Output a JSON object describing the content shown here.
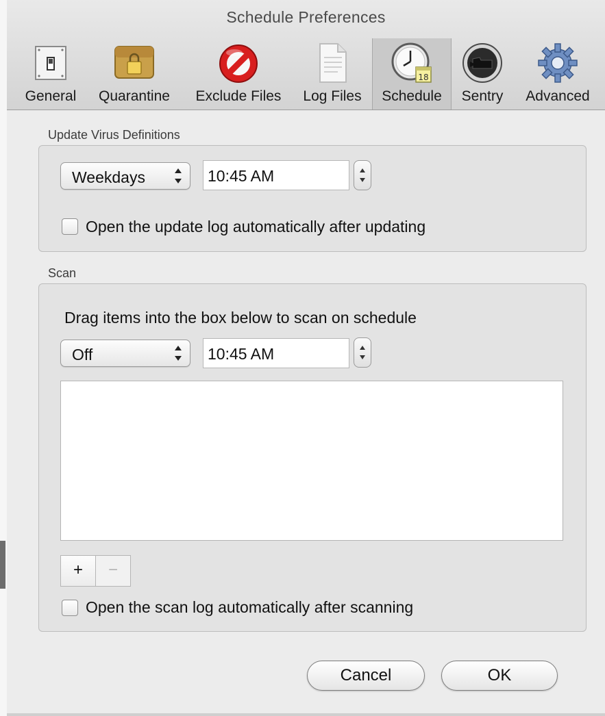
{
  "window": {
    "title": "Schedule Preferences"
  },
  "toolbar": {
    "tabs": [
      {
        "label": "General",
        "icon": "switch-panel-icon"
      },
      {
        "label": "Quarantine",
        "icon": "locked-box-icon"
      },
      {
        "label": "Exclude Files",
        "icon": "no-sign-icon"
      },
      {
        "label": "Log Files",
        "icon": "document-icon"
      },
      {
        "label": "Schedule",
        "icon": "clock-calendar-icon",
        "selected": true
      },
      {
        "label": "Sentry",
        "icon": "sentry-icon"
      },
      {
        "label": "Advanced",
        "icon": "gear-icon"
      }
    ]
  },
  "update": {
    "group_label": "Update Virus Definitions",
    "frequency": "Weekdays",
    "time": "10:45 AM",
    "open_log_label": "Open the update log automatically after updating",
    "open_log_checked": false
  },
  "scan": {
    "group_label": "Scan",
    "instruction": "Drag items into the box below to scan on schedule",
    "frequency": "Off",
    "time": "10:45 AM",
    "add_label": "+",
    "remove_label": "−",
    "open_log_label": "Open the scan log automatically after scanning",
    "open_log_checked": false
  },
  "buttons": {
    "cancel": "Cancel",
    "ok": "OK"
  },
  "colors": {
    "window_bg": "#ececec",
    "group_bg": "#e3e3e3",
    "toolbar_selected": "#c9c9c9"
  }
}
